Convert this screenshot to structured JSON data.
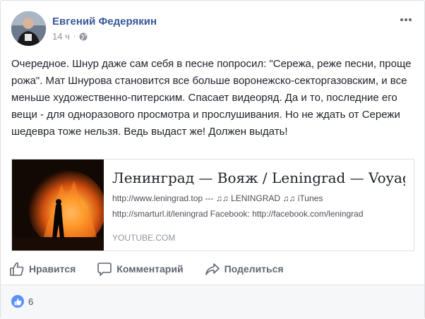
{
  "post": {
    "author": "Евгений Федерякин",
    "time": "14 ч",
    "time_separator": "·",
    "text": "Очередное. Шнур даже сам себя в песне попросил: \"Сережа, реже песни, проще рожа\". Мат Шнурова становится все больше воронежско-секторгазовским, и все меньше художественно-питерским. Спасает видеоряд. Да и то, последние его вещи - для одноразового просмотра и прослушивания. Но не ждать от Сережи шедевра тоже нельзя. Ведь выдаст же! Должен выдать!"
  },
  "link": {
    "title": "Ленинград — Вояж / Leningrad — Voyage",
    "desc_line1": "http://www.leningrad.top --- ♫♫ LENINGRAD ♫♫ iTunes",
    "desc_line2": "http://smarturl.it/leningrad Facebook: http://facebook.com/leningrad",
    "domain": "YOUTUBE.COM"
  },
  "actions": {
    "like": "Нравится",
    "comment": "Комментарий",
    "share": "Поделиться"
  },
  "reactions": {
    "count": "6"
  },
  "icons": {
    "more": "more-horizontal-icon",
    "privacy": "globe-icon",
    "like": "thumbs-up-icon",
    "comment": "comment-bubble-icon",
    "share": "share-arrow-icon"
  },
  "colors": {
    "author_link": "#365899",
    "like_badge": "#5890ff",
    "muted": "#90949c"
  }
}
